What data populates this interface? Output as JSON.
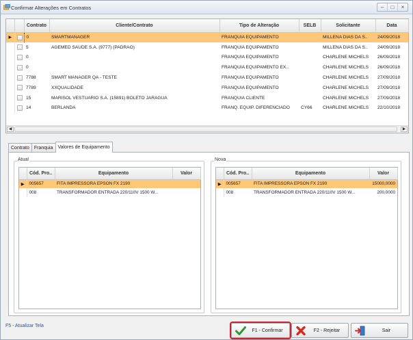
{
  "window": {
    "title": "Confirmar Alterações em Contratos",
    "controls": [
      "–",
      "□",
      "×"
    ]
  },
  "contracts_grid": {
    "columns": [
      "Contrato",
      "Cliente/Contrato",
      "Tipo de Alteração",
      "SELB",
      "Solicitante",
      "Data"
    ],
    "rows": [
      {
        "contrato": "0",
        "cliente": "SMARTMANAGER",
        "tipo": "FRANQUIA EQUIPAMENTO",
        "selb": "",
        "solicitante": "MILLENA DIAS DA S..",
        "data": "24/09/2018"
      },
      {
        "contrato": "5",
        "cliente": "AGEMED SAUDE S.A. (9777) (PADRAO)",
        "tipo": "FRANQUIA EQUIPAMENTO",
        "selb": "",
        "solicitante": "MILLENA DIAS DA S..",
        "data": "24/09/2018"
      },
      {
        "contrato": "0",
        "cliente": "",
        "tipo": "FRANQUIA EQUIPAMENTO",
        "selb": "",
        "solicitante": "CHARLENE MICHELS",
        "data": "26/09/2018"
      },
      {
        "contrato": "0",
        "cliente": "",
        "tipo": "FRANQUIA EQUIPAMENTO EX..",
        "selb": "",
        "solicitante": "CHARLENE MICHELS",
        "data": "26/09/2018"
      },
      {
        "contrato": "7788",
        "cliente": "SMART MANAGER QA - TESTE",
        "tipo": "FRANQUIA EQUIPAMENTO",
        "selb": "",
        "solicitante": "CHARLENE MICHELS",
        "data": "27/09/2018"
      },
      {
        "contrato": "7789",
        "cliente": "XXQUALIDADE",
        "tipo": "FRANQUIA EQUIPAMENTO",
        "selb": "",
        "solicitante": "CHARLENE MICHELS",
        "data": "27/09/2018"
      },
      {
        "contrato": "15",
        "cliente": "MARISOL VESTUARIO S.A. (15891) BOLETO JARAGUA",
        "tipo": "FRANQUIA CLIENTE",
        "selb": "",
        "solicitante": "CHARLENE MICHELS",
        "data": "27/09/2018"
      },
      {
        "contrato": "14",
        "cliente": "BERLANDA",
        "tipo": "FRANQ. EQUIP. DIFERENCIADO",
        "selb": "CY66",
        "solicitante": "CHARLENE MICHELS",
        "data": "22/10/2018"
      }
    ]
  },
  "tabs": [
    "Contrato",
    "Franquia",
    "Valores de Equipamento"
  ],
  "atual": {
    "legend": "Atual",
    "columns": [
      "Cód. Pro..",
      "Equipamento",
      "Valor"
    ],
    "rows": [
      {
        "cod": "005657",
        "equipamento": "FITA IMPRESSORA EPSON  FX 2190",
        "valor": ""
      },
      {
        "cod": "008",
        "equipamento": "TRANSFORMADOR ENTRADA 220/110V 1500 W...",
        "valor": ""
      }
    ]
  },
  "nova": {
    "legend": "Nova",
    "columns": [
      "Cód. Pro..",
      "Equipamento",
      "Valor"
    ],
    "rows": [
      {
        "cod": "005657",
        "equipamento": "FITA IMPRESSORA EPSON  FX 2190",
        "valor": "15000,0000"
      },
      {
        "cod": "008",
        "equipamento": "TRANSFORMADOR ENTRADA 220/110V 1500 W...",
        "valor": "200,0000"
      }
    ]
  },
  "footer": {
    "refresh_label": "F5 - Atualizar Tela",
    "confirm_label": "F1 - Confirmar",
    "reject_label": "F2 - Rejeitar",
    "exit_label": "Sair"
  },
  "colors": {
    "selected_row": "#ffc777",
    "focus_outline": "#d02330",
    "link": "#1a56b8"
  },
  "icons": {
    "confirm": "check-icon",
    "reject": "x-icon",
    "exit": "exit-door-icon"
  }
}
